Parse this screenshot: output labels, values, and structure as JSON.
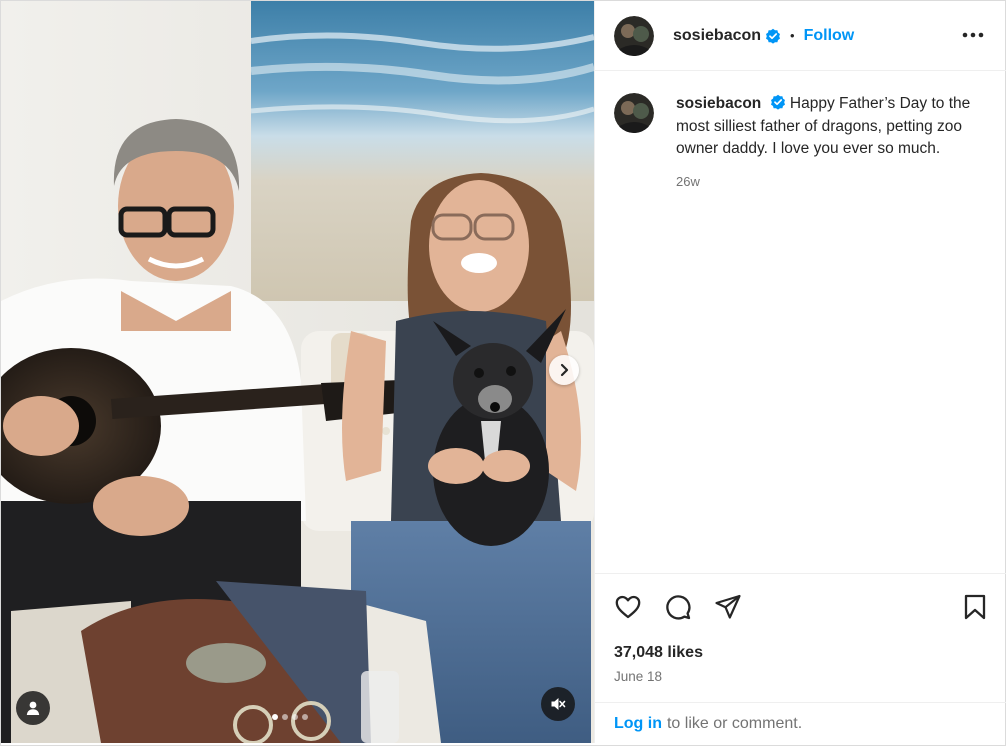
{
  "post": {
    "author": {
      "username": "sosiebacon",
      "verified_icon": "verified-badge-icon",
      "follow_label": "Follow",
      "bullet": "•"
    },
    "caption": {
      "username": "sosiebacon",
      "text": "Happy Father’s Day to the most silliest father of dragons, petting zoo owner daddy. I love you ever so much.",
      "time": "26w"
    },
    "stats": {
      "likes": "37,048 likes",
      "date": "June 18"
    },
    "login_prompt": {
      "link": "Log in",
      "rest": "to like or comment."
    },
    "media": {
      "carousel_count": 4,
      "carousel_active_index": 0,
      "icons": [
        "chevron-right-icon",
        "user-tag-icon",
        "muted-speaker-icon"
      ]
    },
    "colors": {
      "accent": "#0095f6",
      "text": "#262626",
      "secondary_text": "#737373",
      "border": "#efefef"
    }
  }
}
